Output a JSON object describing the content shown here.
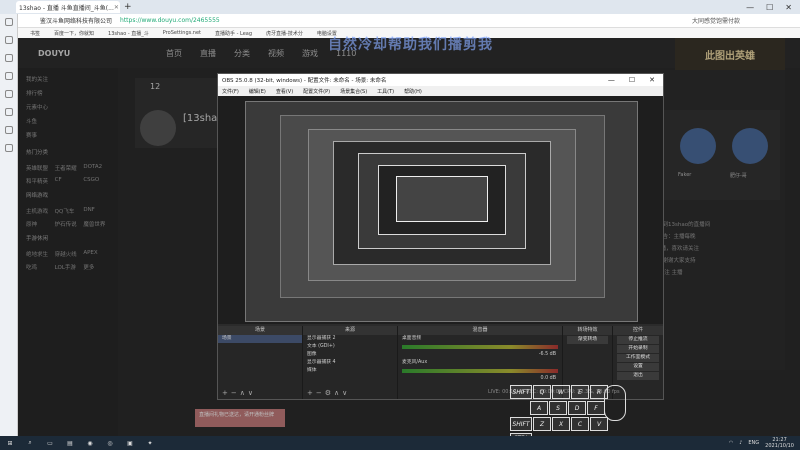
{
  "browser": {
    "tab_title": "13shao - 直播 斗鱼直播间_斗鱼(...",
    "new_tab": "+",
    "address_prefix": "鉴汉斗鱼网络科技有限公司",
    "url": "https://www.douyu.com/2465555",
    "address_right": "大同感觉饱需付款",
    "bookmarks": [
      "书签",
      "百度一下，你就知",
      "13shao - 直播_斗",
      "ProSettings.net",
      "直播助手 - Leag",
      "虎牙直播-技术分",
      "电脑设置"
    ],
    "window_controls": [
      "—",
      "☐",
      "✕"
    ]
  },
  "site": {
    "overlay_title": "自然冷却帮助我们播剪我",
    "nav": [
      "首页",
      "直播",
      "分类",
      "视频",
      "游戏",
      "1110"
    ],
    "logo_text": "DOUYU",
    "banner_text": "此图出英雄",
    "sidebar_top": [
      "我的关注",
      "排行榜",
      "元素中心",
      "斗鱼",
      "赛事"
    ],
    "sidebar_heads": [
      "热门分类",
      "网络游戏",
      "手游休闲"
    ],
    "sidebar_grid": [
      "英雄联盟",
      "王者荣耀",
      "DOTA2",
      "和平精英",
      "CF",
      "CSGO",
      "主机游戏",
      "QQ飞车",
      "DNF",
      "原神",
      "炉石传说",
      "魔兽世界",
      "绝地求生",
      "穿越火线",
      "APEX",
      "吃鸡",
      "LOL手游",
      "更多"
    ],
    "room_count": "12",
    "room_name": "[13shao]",
    "promo_names": [
      "Faker",
      "肥仔-哥"
    ],
    "right_text": [
      "欢迎来到13shao的直播间",
      "直播公告：主播每晚",
      "8点开播，喜欢请关注",
      "订阅，谢谢大家支持",
      "大家 关注 主播"
    ],
    "pink_msg": "直播间礼物已送达，请开通粉丝牌"
  },
  "obs": {
    "title": "OBS 25.0.8 (32-bit, windows) - 配置文件: 未命名 - 场景: 未命名",
    "menu": [
      "文件(F)",
      "编辑(E)",
      "查看(V)",
      "配置文件(P)",
      "场景集合(S)",
      "工具(T)",
      "帮助(H)"
    ],
    "docks": {
      "scenes": {
        "title": "场景",
        "items": [
          "场景"
        ]
      },
      "sources": {
        "title": "来源",
        "items": [
          "显示器捕获 2",
          "文本 (GDI+)",
          "图像",
          "显示器捕获 4",
          "媒体"
        ]
      },
      "mixer": {
        "title": "混音器",
        "tracks": [
          {
            "name": "桌面音频",
            "db": "-6.5 dB"
          },
          {
            "name": "麦克风/Aux",
            "db": "0.0 dB"
          }
        ]
      },
      "transitions": {
        "title": "转场特效",
        "value": "渐变转场"
      },
      "controls": {
        "title": "控件",
        "buttons": [
          "停止推流",
          "开始录制",
          "工作室模式",
          "设置",
          "退出"
        ]
      }
    },
    "status": "LIVE: 00:12:45  REC: 00:00:00  CPU: 12.3%, 30.00 fps"
  },
  "keyboard": {
    "rows": [
      [
        "SHIFT",
        "Q",
        "W",
        "E",
        "R"
      ],
      [
        "A",
        "S",
        "D",
        "F"
      ],
      [
        "SHIFT",
        "Z",
        "X",
        "C",
        "V"
      ],
      [
        "CTRL"
      ]
    ]
  },
  "taskbar": {
    "lang": "ENG",
    "time": "21:27",
    "date": "2021/10/10"
  }
}
